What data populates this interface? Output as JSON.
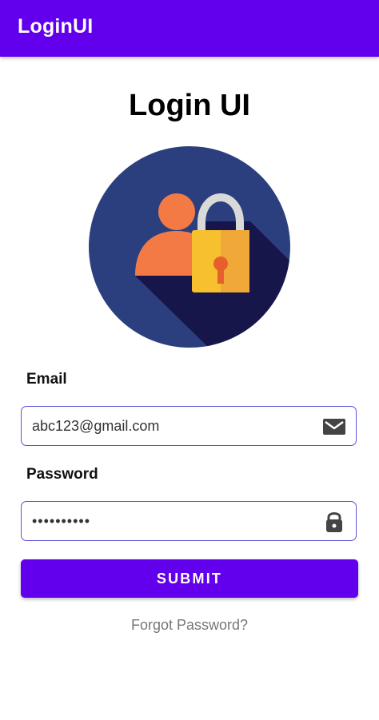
{
  "app_bar": {
    "title": "LoginUI",
    "color": "#6200EE"
  },
  "main": {
    "title": "Login UI",
    "hero_icon": "user-lock-icon"
  },
  "form": {
    "email": {
      "label": "Email",
      "value": "abc123@gmail.com",
      "icon": "email-icon"
    },
    "password": {
      "label": "Password",
      "value": "••••••••••",
      "icon": "lock-icon"
    },
    "submit_label": "SUBMIT",
    "forgot_label": "Forgot Password?"
  },
  "colors": {
    "accent": "#6200EE",
    "field_border": "#5B54D6",
    "hero_background": "#2B3F7E",
    "person": "#F47A45",
    "padlock": "#F6C02F"
  }
}
